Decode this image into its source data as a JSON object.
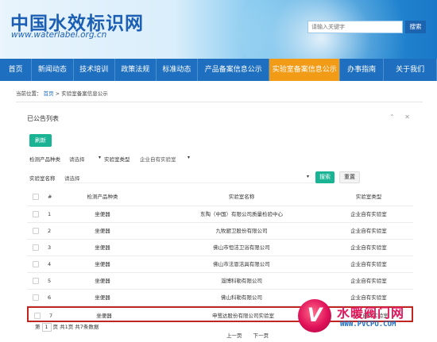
{
  "header": {
    "logo_cn": "中国水效标识网",
    "logo_url": "www.waterlabel.org.cn",
    "search_placeholder": "请输入关键字",
    "search_button": "搜索"
  },
  "nav": [
    {
      "label": "首页",
      "width": 40
    },
    {
      "label": "新闻动态",
      "width": 52
    },
    {
      "label": "技术培训",
      "width": 52
    },
    {
      "label": "政策法规",
      "width": 52
    },
    {
      "label": "标准动态",
      "width": 52
    },
    {
      "label": "产品备案信息公示",
      "width": 91
    },
    {
      "label": "实验室备案信息公示",
      "width": 89,
      "active": true
    },
    {
      "label": "办事指南",
      "width": 55
    },
    {
      "label": "关于我们",
      "width": 67
    }
  ],
  "breadcrumb": {
    "prefix": "当前位置：",
    "home": "首页",
    "sep": ">",
    "current": "实验室备案信息公示"
  },
  "panel": {
    "title": "已公告列表",
    "collapse_icon": "chevron-up-icon",
    "close_icon": "close-icon",
    "refresh": "刷新"
  },
  "filters": {
    "product_type_label": "检测产品种类",
    "product_type_value": "请选择",
    "lab_type_label": "实验室类型",
    "lab_type_value": "企业自有实验室",
    "lab_name_label": "实验室名称",
    "lab_name_value": "请选择",
    "search": "搜索",
    "reset": "重置"
  },
  "table": {
    "headers": [
      "#",
      "检测产品种类",
      "实验室名称",
      "实验室类型"
    ],
    "rows": [
      {
        "num": "1",
        "type": "坐便器",
        "name": "东陶（中国）有限公司质量检验中心",
        "category": "企业自有实验室"
      },
      {
        "num": "2",
        "type": "坐便器",
        "name": "九牧厨卫股份有限公司",
        "category": "企业自有实验室"
      },
      {
        "num": "3",
        "type": "坐便器",
        "name": "佛山市恒洁卫浴有限公司",
        "category": "企业自有实验室"
      },
      {
        "num": "4",
        "type": "坐便器",
        "name": "佛山市法恩洁具有限公司",
        "category": "企业自有实验室"
      },
      {
        "num": "5",
        "type": "坐便器",
        "name": "淄博科勒有限公司",
        "category": "企业自有实验室"
      },
      {
        "num": "6",
        "type": "坐便器",
        "name": "佛山科勒有限公司",
        "category": "企业自有实验室"
      },
      {
        "num": "7",
        "type": "坐便器",
        "name": "申鹭达股份有限公司实验室",
        "category": "企业自有实验室"
      }
    ]
  },
  "pager": {
    "page_prefix": "第",
    "page_value": "1",
    "page_suffix": "页 共1页 共7条数据",
    "prev": "上一页",
    "next": "下一页"
  },
  "watermark": {
    "logo_letter": "V",
    "text": "水暖阀门网",
    "url": "WWW.PVCPU.COM"
  },
  "colors": {
    "nav_blue": "#1f6fc0",
    "nav_active": "#f29b16",
    "green_button": "#1ab394",
    "highlight_red": "#c0261f"
  }
}
